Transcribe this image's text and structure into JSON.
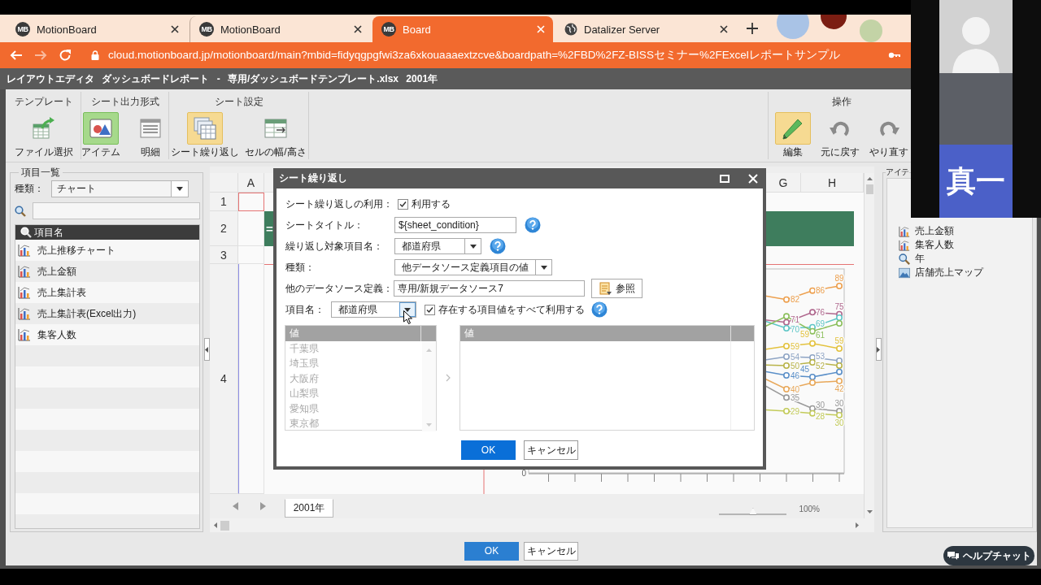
{
  "browser": {
    "tabs": [
      {
        "label": "MotionBoard",
        "selected": false,
        "kind": "logo",
        "favicon_text": "MB"
      },
      {
        "label": "MotionBoard",
        "selected": false,
        "kind": "logo",
        "favicon_text": "MB"
      },
      {
        "label": "Board",
        "selected": true,
        "kind": "logo",
        "favicon_text": "MB"
      },
      {
        "label": "Datalizer Server",
        "selected": false,
        "kind": "globe"
      }
    ],
    "nav": [
      {
        "kind": "back",
        "disabled": false
      },
      {
        "kind": "forward",
        "disabled": true
      },
      {
        "kind": "reload",
        "disabled": false
      }
    ],
    "url": "cloud.motionboard.jp/motionboard/main?mbid=fidyqgpgfwi3za6xkouaaaextzcve&boardpath=%2FBD%2FZ-BISSセミナー%2FExcelレポートサンプル"
  },
  "app": {
    "title": "レイアウトエディタ ダッシュボードレポート - 専用/ダッシュボードテンプレート.xlsx 2001年",
    "toolbar": {
      "left_groups": [
        {
          "label": "テンプレート",
          "kind": "action",
          "buttons": [
            {
              "label": "ファイル選択",
              "kind": "file",
              "selected": false
            }
          ]
        },
        {
          "label": "シート出力形式",
          "kind": "radio",
          "buttons": [
            {
              "label": "アイテム",
              "kind": "item",
              "selected": true
            },
            {
              "label": "明細",
              "kind": "detail",
              "selected": false
            }
          ]
        },
        {
          "label": "シート設定",
          "kind": "toggle",
          "buttons": [
            {
              "label": "シート繰り返し",
              "kind": "repeat",
              "selected": true
            },
            {
              "label": "セルの幅/高さ",
              "kind": "cell-size",
              "selected": false
            }
          ]
        }
      ],
      "right_groups": [
        {
          "label": "操作",
          "kind": "toggle",
          "buttons": [
            {
              "label": "編集",
              "kind": "edit",
              "selected": true
            },
            {
              "label": "元に戻す",
              "kind": "undo",
              "selected": false
            },
            {
              "label": "やり直す",
              "kind": "redo",
              "selected": false
            }
          ]
        }
      ]
    },
    "item_list_panel": {
      "title": "項目一覧",
      "type_label": "種類：",
      "type_value": "チャート",
      "column_header": "項目名",
      "items": [
        {
          "label": "売上推移チャート"
        },
        {
          "label": "売上金額"
        },
        {
          "label": "売上集計表"
        },
        {
          "label": "売上集計表(Excel出力)"
        },
        {
          "label": "集客人数"
        }
      ]
    },
    "sheet": {
      "columns": [
        {
          "label": "A"
        },
        {
          "label": "G"
        },
        {
          "label": "H"
        }
      ],
      "rows": [
        {
          "number": "1",
          "a_selected": true
        },
        {
          "number": "2",
          "a_selected": false,
          "banner": "="
        },
        {
          "number": "3",
          "a_selected": false
        },
        {
          "number": "4",
          "a_selected": false
        }
      ],
      "chart": {
        "axis_label": "0",
        "series": [
          {
            "color": "#eda04f",
            "labels": [
              "82",
              "86",
              "89"
            ]
          },
          {
            "color": "#b0688e",
            "labels": [
              "71",
              "76",
              "75"
            ]
          },
          {
            "color": "#5fc6c6",
            "labels": [
              "70",
              "69"
            ]
          },
          {
            "color": "#8cbf5c",
            "labels": [
              "61"
            ]
          },
          {
            "color": "#e3c23e",
            "labels": [
              "59",
              "59",
              "59"
            ]
          },
          {
            "color": "#8ea4c4",
            "labels": [
              "54",
              "53"
            ]
          },
          {
            "color": "#b9b44a",
            "labels": [
              "50",
              "52"
            ]
          },
          {
            "color": "#5a8fc8",
            "labels": [
              "46",
              "45"
            ]
          },
          {
            "color": "#e8a85a",
            "labels": [
              "40",
              "42"
            ]
          },
          {
            "color": "#999999",
            "labels": [
              "35",
              "30",
              "30"
            ]
          },
          {
            "color": "#c3cb5a",
            "labels": [
              "29",
              "28",
              "30"
            ]
          }
        ]
      },
      "sheet_tabs": [
        {
          "label": "2001年",
          "selected": true
        }
      ],
      "zoom": {
        "level": 0.5,
        "reading": "100%"
      }
    },
    "item_panel": {
      "title": "アイテ",
      "items": [
        {
          "label": "売上金額",
          "kind": "chart"
        },
        {
          "label": "集客人数",
          "kind": "chart"
        },
        {
          "label": "年",
          "kind": "search"
        },
        {
          "label": "店舗売上マップ",
          "kind": "map"
        }
      ]
    },
    "footer_buttons": [
      {
        "label": "OK",
        "kind": "ok"
      },
      {
        "label": "キャンセル",
        "kind": "cancel"
      }
    ],
    "help_chat": "ヘルプチャット"
  },
  "dialog": {
    "title": "シート繰り返し",
    "fields": [
      {
        "kind": "checkbox",
        "label": "シート繰り返しの利用：",
        "option": "利用する",
        "checked": true
      },
      {
        "kind": "text",
        "label": "シートタイトル：",
        "value": "${sheet_condition}",
        "help": true
      },
      {
        "kind": "select",
        "label": "繰り返し対象項目名：",
        "value": "都道府県",
        "help": true
      },
      {
        "kind": "select",
        "label": "種類：",
        "value": "他データソース定義項目の値"
      },
      {
        "kind": "browse",
        "label": "他のデータソース定義：",
        "value": "専用/新規データソース7",
        "button": "参照"
      }
    ],
    "item_row": {
      "label": "項目名：",
      "value": "都道府県",
      "arrow_hovered": true,
      "option": "存在する項目値をすべて利用する",
      "checked": true,
      "help": true
    },
    "source_list": {
      "header": "値",
      "disabled": true,
      "items": [
        "千葉県",
        "埼玉県",
        "大阪府",
        "山梨県",
        "愛知県",
        "東京都"
      ]
    },
    "target_list": {
      "header": "値"
    },
    "buttons": [
      {
        "label": "OK",
        "kind": "ok"
      },
      {
        "label": "キャンセル",
        "kind": "cancel"
      }
    ]
  },
  "video_call": {
    "tiles": [
      {
        "kind": "avatar"
      },
      {
        "kind": "camera"
      },
      {
        "kind": "name",
        "text": "真一"
      }
    ]
  }
}
